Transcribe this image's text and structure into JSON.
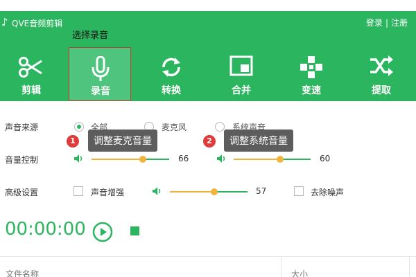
{
  "app": {
    "title": "QVE音频剪辑",
    "auth": {
      "login": "登录",
      "separator": "|",
      "register": "注册"
    }
  },
  "callout": {
    "select_record": "选择录音"
  },
  "toolbar": {
    "items": [
      {
        "label": "剪辑",
        "icon": "scissors-icon"
      },
      {
        "label": "录音",
        "icon": "microphone-icon",
        "active": true
      },
      {
        "label": "转换",
        "icon": "convert-arrows-icon"
      },
      {
        "label": "合并",
        "icon": "merge-icon"
      },
      {
        "label": "变速",
        "icon": "speed-dpad-icon"
      },
      {
        "label": "提取",
        "icon": "shuffle-icon"
      }
    ]
  },
  "source": {
    "label": "声音来源",
    "options": [
      "全部",
      "麦克风",
      "系统声音"
    ],
    "selected": "全部"
  },
  "tips": {
    "mic": {
      "badge": "1",
      "text": "调整麦克音量"
    },
    "system": {
      "badge": "2",
      "text": "调整系统音量"
    }
  },
  "volume": {
    "label": "音量控制",
    "mic": {
      "value": "66",
      "fraction": 0.66
    },
    "system": {
      "value": "60",
      "fraction": 0.6
    }
  },
  "advanced": {
    "label": "高级设置",
    "enhance_label": "声音增强",
    "enhance_value": "57",
    "enhance_fraction": 0.57,
    "denoise_label": "去除噪声"
  },
  "recorder": {
    "time": "00:00:00"
  },
  "file_list": {
    "col_name": "文件名称",
    "col_size": "大小"
  },
  "colors": {
    "brand": "#2cb55f",
    "slider_fill": "#f0b43a",
    "tip_bg": "#5d5d5d",
    "badge": "#e23a3a"
  }
}
